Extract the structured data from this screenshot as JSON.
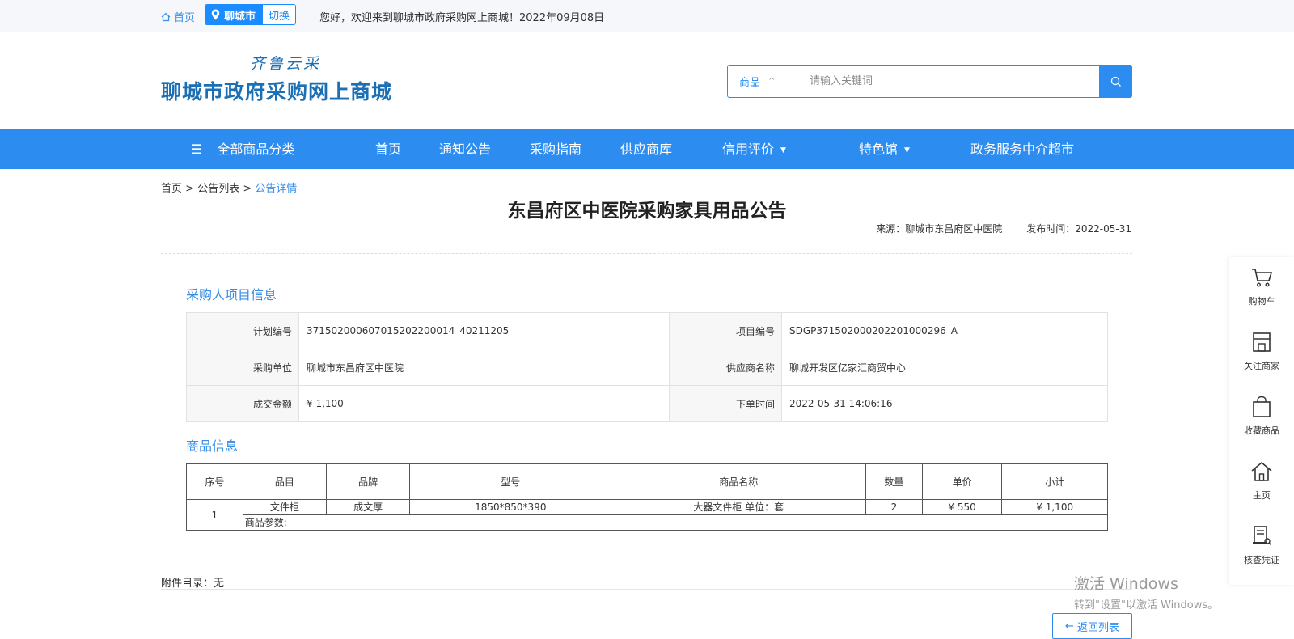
{
  "topbar": {
    "home_label": "首页",
    "city_label": "聊城市",
    "switch_label": "切换",
    "welcome": "您好，欢迎来到聊城市政府采购网上商城！2022年09月08日"
  },
  "header": {
    "logo_top": "齐鲁云采",
    "logo_main": "聊城市政府采购网上商城",
    "search_category": "商品",
    "search_placeholder": "请输入关键词"
  },
  "nav": {
    "all_categories": "全部商品分类",
    "items": [
      "首页",
      "通知公告",
      "采购指南",
      "供应商库",
      "信用评价",
      "特色馆",
      "政务服务中介超市"
    ]
  },
  "breadcrumb": {
    "home": "首页",
    "list": "公告列表",
    "current": "公告详情",
    "sep": ">"
  },
  "notice": {
    "title": "东昌府区中医院采购家具用品公告",
    "source": "来源：聊城市东昌府区中医院",
    "publish_time": "发布时间：2022-05-31"
  },
  "buyer_section": {
    "title": "采购人项目信息",
    "rows": [
      {
        "l1": "计划编号",
        "v1": "371502000607015202200014_40211205",
        "l2": "项目编号",
        "v2": "SDGP371502000202201000296_A"
      },
      {
        "l1": "采购单位",
        "v1": "聊城市东昌府区中医院",
        "l2": "供应商名称",
        "v2": "聊城开发区亿家汇商贸中心"
      },
      {
        "l1": "成交金额",
        "v1": "¥ 1,100",
        "l2": "下单时间",
        "v2": "2022-05-31 14:06:16"
      }
    ]
  },
  "goods_section": {
    "title": "商品信息",
    "headers": [
      "序号",
      "品目",
      "品牌",
      "型号",
      "商品名称",
      "数量",
      "单价",
      "小计"
    ],
    "rows": [
      {
        "index": "1",
        "category": "文件柜",
        "brand": "成文厚",
        "model": "1850*850*390",
        "name": "大器文件柜 单位：套",
        "qty": "2",
        "price": "¥ 550",
        "subtotal": "¥ 1,100",
        "params": "商品参数:"
      }
    ]
  },
  "attachments": "附件目录：无",
  "back_button": "返回列表",
  "back_arrow": "←",
  "sidebar": {
    "items": [
      {
        "label": "购物车",
        "icon": "cart-icon"
      },
      {
        "label": "关注商家",
        "icon": "shop-icon"
      },
      {
        "label": "收藏商品",
        "icon": "bag-icon"
      },
      {
        "label": "主页",
        "icon": "home-icon"
      },
      {
        "label": "核查凭证",
        "icon": "verify-icon"
      }
    ]
  },
  "watermark": {
    "line1": "激活 Windows",
    "line2": "转到\"设置\"以激活 Windows。"
  },
  "colors": {
    "primary": "#2d8cf0",
    "link": "#3a8ee6",
    "logo": "#1a6fb5"
  }
}
